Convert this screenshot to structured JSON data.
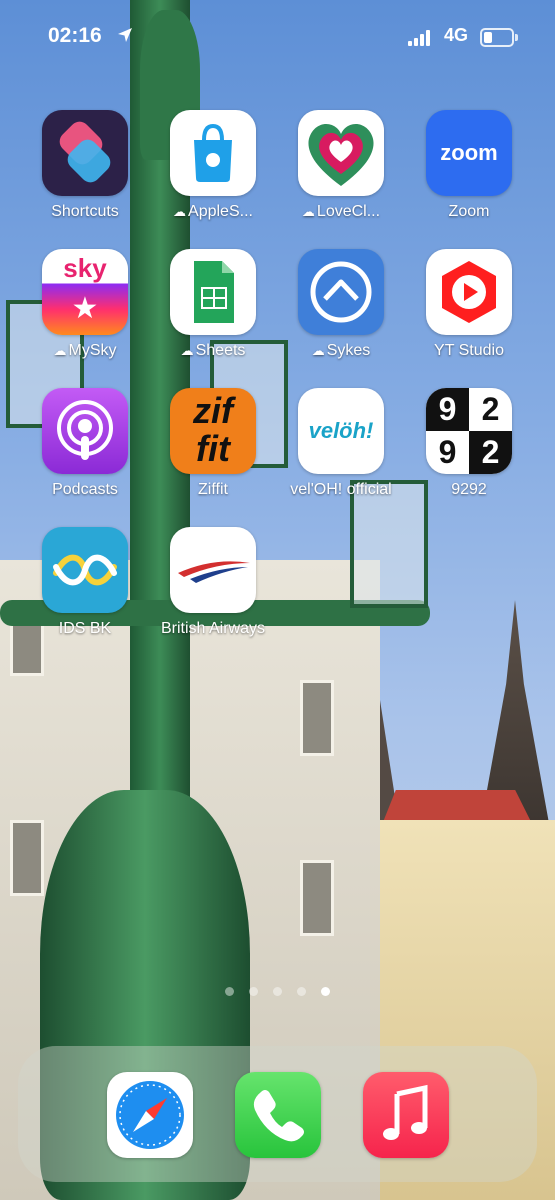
{
  "status_bar": {
    "time": "02:16",
    "location_icon": "location-arrow-icon",
    "network": "4G",
    "battery_icon": "battery-low-icon"
  },
  "home_apps": [
    {
      "label": "Shortcuts",
      "icon": "shortcuts-icon",
      "cloud": false
    },
    {
      "label": "AppleS...",
      "icon": "apple-store-icon",
      "cloud": true
    },
    {
      "label": "LoveCl...",
      "icon": "heart-icon",
      "cloud": true
    },
    {
      "label": "Zoom",
      "icon": "zoom-icon",
      "cloud": false
    },
    {
      "label": "MySky",
      "icon": "sky-icon",
      "cloud": true
    },
    {
      "label": "Sheets",
      "icon": "sheets-icon",
      "cloud": true
    },
    {
      "label": "Sykes",
      "icon": "sykes-house-icon",
      "cloud": true
    },
    {
      "label": "YT Studio",
      "icon": "yt-studio-icon",
      "cloud": false
    },
    {
      "label": "Podcasts",
      "icon": "podcasts-icon",
      "cloud": false
    },
    {
      "label": "Ziffit",
      "icon": "ziffit-icon",
      "cloud": false
    },
    {
      "label": "vel'OH! official",
      "icon": "veloh-icon",
      "cloud": false
    },
    {
      "label": "9292",
      "icon": "9292-icon",
      "cloud": false
    },
    {
      "label": "IDS BK",
      "icon": "ids-bk-icon",
      "cloud": false
    },
    {
      "label": "British Airways",
      "icon": "british-airways-icon",
      "cloud": false
    }
  ],
  "icon_text": {
    "zoom": "zoom",
    "sky": "sky",
    "ziffit_top": "zif",
    "ziffit_bottom": "fit",
    "veloh": "velöh!",
    "n9292": [
      "9",
      "2",
      "9",
      "2"
    ]
  },
  "page_dots": {
    "count": 5,
    "active_index": 4
  },
  "dock": [
    {
      "icon": "safari-compass-icon"
    },
    {
      "icon": "phone-icon"
    },
    {
      "icon": "music-icon"
    }
  ]
}
